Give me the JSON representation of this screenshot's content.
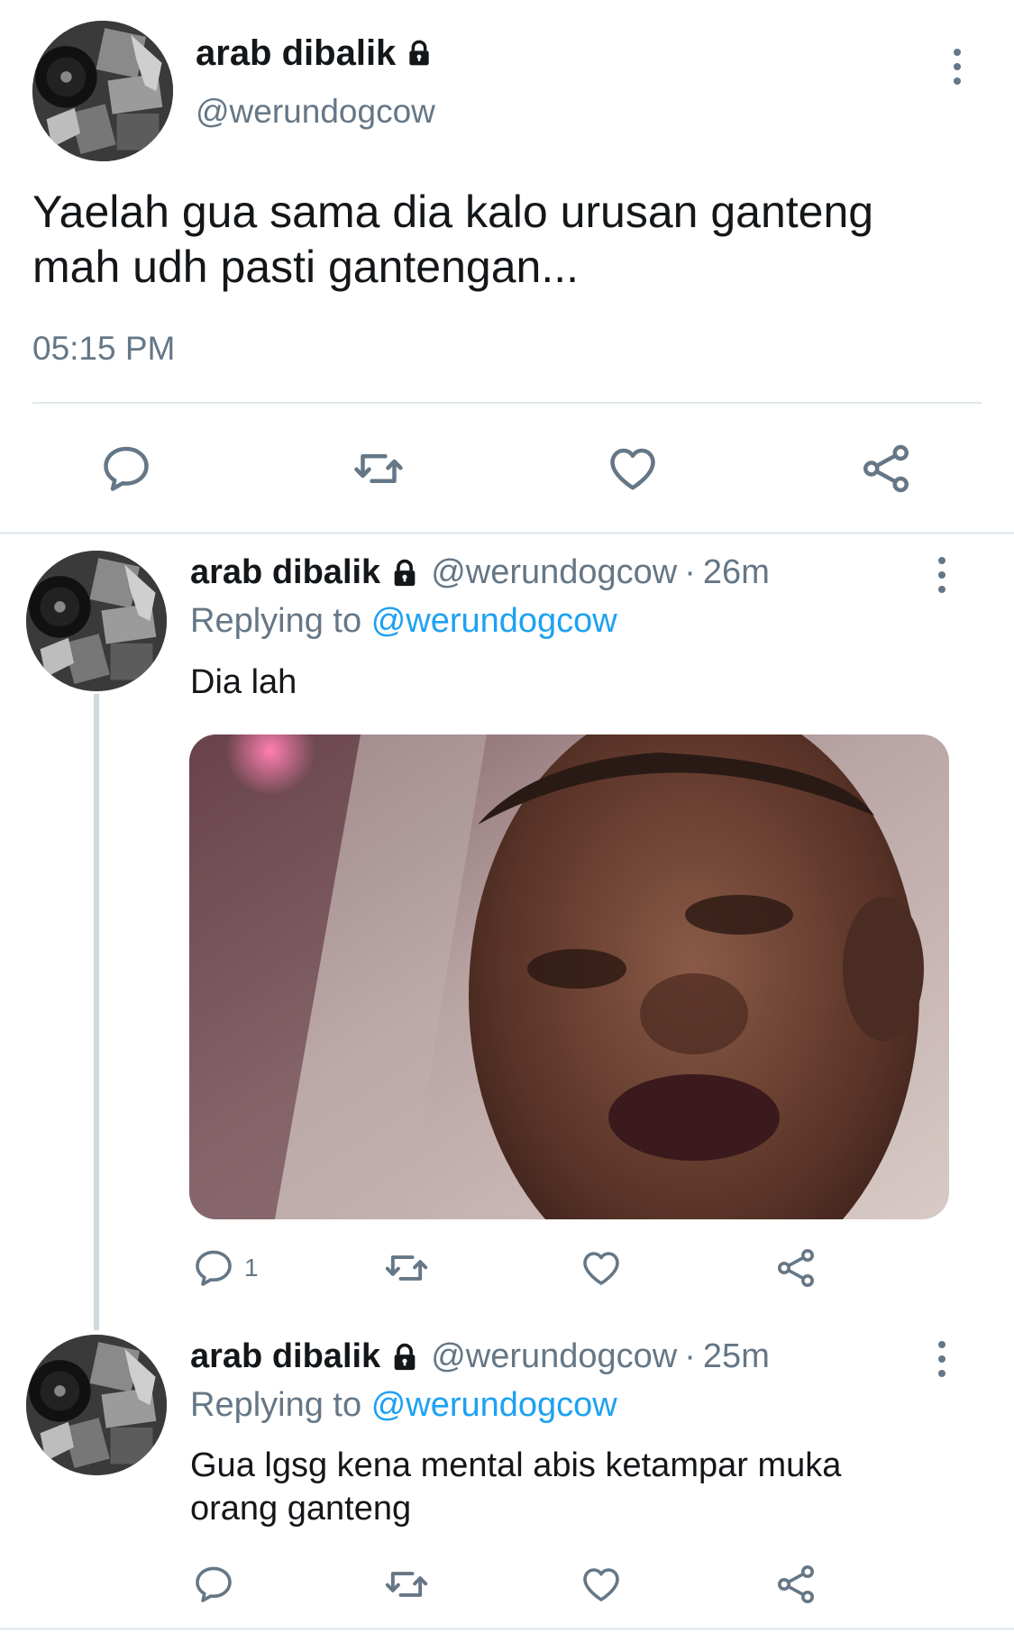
{
  "main_tweet": {
    "name": "arab dibalik",
    "handle": "@werundogcow",
    "text": "Yaelah gua sama dia kalo urusan ganteng mah udh pasti gantengan...",
    "time": "05:15 PM",
    "actions": [
      "reply-icon",
      "retweet-icon",
      "like-icon",
      "share-icon"
    ]
  },
  "replies": [
    {
      "name": "arab dibalik",
      "handle": "@werundogcow",
      "separator": "·",
      "time": "26m",
      "replying_label": "Replying to",
      "replying_to": "@werundogcow",
      "text": "Dia lah",
      "has_photo": true,
      "reply_count": "1"
    },
    {
      "name": "arab dibalik",
      "handle": "@werundogcow",
      "separator": "·",
      "time": "25m",
      "replying_label": "Replying to",
      "replying_to": "@werundogcow",
      "text": "Gua lgsg kena mental abis ketampar muka orang ganteng",
      "has_photo": false,
      "reply_count": ""
    }
  ],
  "colors": {
    "text": "#14171a",
    "secondary": "#657786",
    "link": "#1da1f2",
    "divider": "#e1e8ed",
    "thread_line": "#cfd9de"
  },
  "icons": [
    "lock-icon",
    "more-icon",
    "reply-icon",
    "retweet-icon",
    "like-icon",
    "share-icon"
  ]
}
